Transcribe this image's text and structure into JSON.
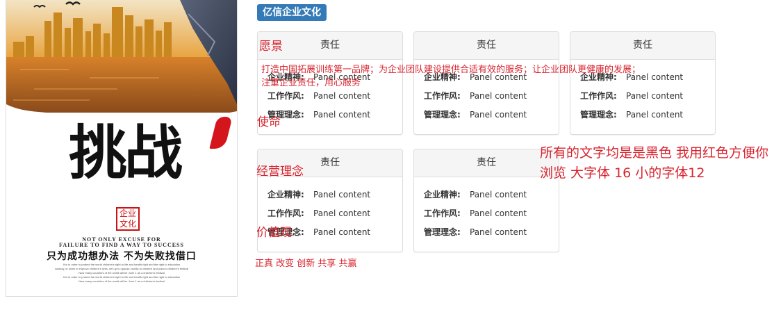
{
  "poster": {
    "big_text": "挑战",
    "seal_text": "企业文化",
    "en_line1": "NOT ONLY EXCUSE FOR",
    "en_line2": "FAILURE TO FIND A WAY TO SUCCESS",
    "slogan": "只为成功想办法 不为失败找借口",
    "fine_print": [
      "It is in order to protect the world children's right to life and health right and the right to education",
      "custody, in order to improve children's lives, set up to oppose cruelty to children and poison children's festival",
      "Now many countries of the world will be June 1 as a children's festival",
      "It is in order to protect the world children's right to life and health right and the right to education",
      "Now many countries of the world will be June 1 as a children's festival"
    ]
  },
  "section_badge": "亿信企业文化",
  "panels": [
    {
      "title": "责任",
      "rows": [
        {
          "label": "企业精神:",
          "value": "Panel content"
        },
        {
          "label": "工作作风:",
          "value": "Panel content"
        },
        {
          "label": "管理理念:",
          "value": "Panel content"
        }
      ]
    },
    {
      "title": "责任",
      "rows": [
        {
          "label": "企业精神:",
          "value": "Panel content"
        },
        {
          "label": "工作作风:",
          "value": "Panel content"
        },
        {
          "label": "管理理念:",
          "value": "Panel content"
        }
      ]
    },
    {
      "title": "责任",
      "rows": [
        {
          "label": "企业精神:",
          "value": "Panel content"
        },
        {
          "label": "工作作风:",
          "value": "Panel content"
        },
        {
          "label": "管理理念:",
          "value": "Panel content"
        }
      ]
    },
    {
      "title": "责任",
      "rows": [
        {
          "label": "企业精神:",
          "value": "Panel content"
        },
        {
          "label": "工作作风:",
          "value": "Panel content"
        },
        {
          "label": "管理理念:",
          "value": "Panel content"
        }
      ]
    },
    {
      "title": "责任",
      "rows": [
        {
          "label": "企业精神:",
          "value": "Panel content"
        },
        {
          "label": "工作作风:",
          "value": "Panel content"
        },
        {
          "label": "管理理念:",
          "value": "Panel content"
        }
      ]
    }
  ],
  "annotations": {
    "vision_heading": "愿景",
    "vision_text_line1": "打造中国拓展训练第一品牌；为企业团队建设提供合适有效的服务；让企业团队更健康的发展；",
    "vision_text_line2": "注重企业责任，用心服务",
    "mission_heading": "使命",
    "philosophy_heading": "经营理念",
    "values_heading": "价值观",
    "values_text": "正真 改变 创新 共享 共赢",
    "note": "所有的文字均是是黑色 我用红色方便你浏览 大字体 16 小的字体12"
  },
  "colors": {
    "badge_bg": "#337ab7",
    "annotation_red": "#d9232e",
    "panel_heading_bg": "#f5f5f5",
    "panel_border": "#dddddd"
  }
}
